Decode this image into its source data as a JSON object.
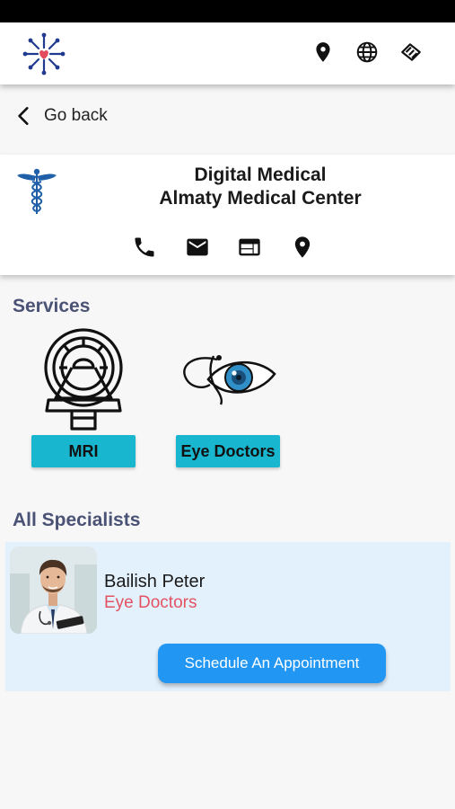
{
  "nav": {
    "back_label": "Go back"
  },
  "center": {
    "title_line1": "Digital Medical",
    "title_line2": "Almaty Medical Center"
  },
  "services": {
    "heading": "Services",
    "items": [
      {
        "label": "MRI",
        "icon": "mri-scanner-icon"
      },
      {
        "label": "Eye Doctors",
        "icon": "eye-stethoscope-icon"
      }
    ]
  },
  "specialists": {
    "heading": "All Specialists",
    "items": [
      {
        "name": "Bailish Peter",
        "specialty": "Eye Doctors",
        "button_label": "Schedule An Appointment"
      }
    ]
  },
  "colors": {
    "accent": "#2196f3",
    "service_label_bg": "#19b7cf",
    "section_heading": "#4a5275",
    "specialty_text": "#e35263",
    "card_bg": "#e3f1fd"
  }
}
